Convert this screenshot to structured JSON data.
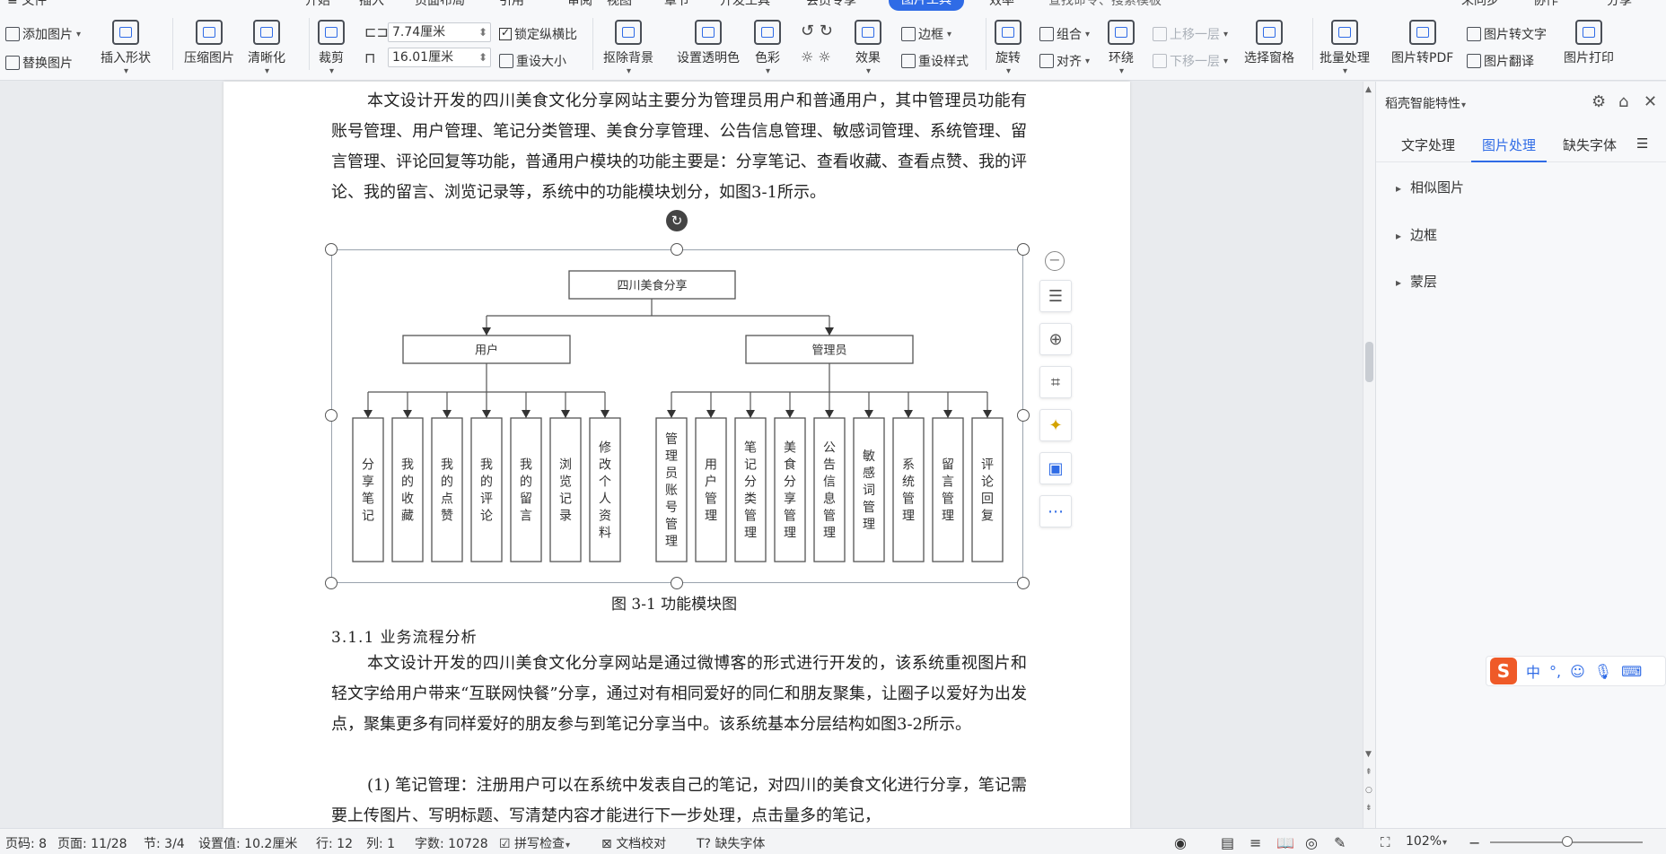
{
  "menu": {
    "items": [
      "文件",
      "开始",
      "插入",
      "页面布局",
      "引用",
      "审阅",
      "视图",
      "章节",
      "开发工具",
      "会员专享",
      "图片工具",
      "效率"
    ],
    "active": "图片工具",
    "right": [
      "未同步",
      "协作",
      "分享"
    ],
    "search_placeholder": "查找命令、搜索模板"
  },
  "ribbon": {
    "add_image": "添加图片",
    "replace_image": "替换图片",
    "insert_shape": "插入形状",
    "compress_image": "压缩图片",
    "sharpen": "清晰化",
    "crop": "裁剪",
    "height_value": "7.74厘米",
    "width_value": "16.01厘米",
    "lock_ratio": "锁定纵横比",
    "reset_size": "重设大小",
    "remove_bg": "抠除背景",
    "set_transparent": "设置透明色",
    "color": "色彩",
    "effects": "效果",
    "border": "边框",
    "reset_style": "重设样式",
    "rotate": "旋转",
    "group": "组合",
    "align": "对齐",
    "wrap": "环绕",
    "bring_forward": "上移一层",
    "send_backward": "下移一层",
    "selection_pane": "选择窗格",
    "batch_process": "批量处理",
    "to_pdf": "图片转PDF",
    "to_text": "图片转文字",
    "translate": "图片翻译",
    "print": "图片打印"
  },
  "document": {
    "para1": "本文设计开发的四川美食文化分享网站主要分为管理员用户和普通用户，其中管理员功能有账号管理、用户管理、笔记分类管理、美食分享管理、公告信息管理、敏感词管理、系统管理、留言管理、评论回复等功能，普通用户模块的功能主要是：分享笔记、查看收藏、查看点赞、我的评论、我的留言、浏览记录等，系统中的功能模块划分，如图3-1所示。",
    "caption": "图 3-1  功能模块图",
    "heading": "3.1.1 业务流程分析",
    "para2": "本文设计开发的四川美食文化分享网站是通过微博客的形式进行开发的，该系统重视图片和轻文字给用户带来“互联网快餐”分享，通过对有相同爱好的同仁和朋友聚集，让圈子以爱好为出发点，聚集更多有同样爱好的朋友参与到笔记分享当中。该系统基本分层结构如图3-2所示。",
    "para3": "(1) 笔记管理：注册用户可以在系统中发表自己的笔记，对四川的美食文化进行分享，笔记需要上传图片、写明标题、写清楚内容才能进行下一步处理，点击量多的笔记，"
  },
  "diagram": {
    "root": "四川美食分享",
    "user": "用户",
    "admin": "管理员",
    "user_children": [
      "分享笔记",
      "我的收藏",
      "我的点赞",
      "我的评论",
      "我的留言",
      "浏览记录",
      "修改个人资料"
    ],
    "admin_children": [
      "管理员账号管理",
      "用户管理",
      "笔记分类管理",
      "美食分享管理",
      "公告信息管理",
      "敏感词管理",
      "系统管理",
      "留言管理",
      "评论回复"
    ]
  },
  "panel": {
    "title": "稻壳智能特性",
    "tabs": [
      "文字处理",
      "图片处理",
      "缺失字体"
    ],
    "active_tab": "图片处理",
    "sections": [
      "相似图片",
      "边框",
      "蒙层"
    ]
  },
  "ime": {
    "mode": "中",
    "punct": "°,"
  },
  "status": {
    "page_code": "页码: 8",
    "page": "页面: 11/28",
    "section": "节: 3/4",
    "setting": "设置值: 10.2厘米",
    "row": "行: 12",
    "col": "列: 1",
    "word_count": "字数: 10728",
    "spell_check": "拼写检查",
    "doc_proof": "文档校对",
    "missing_font": "缺失字体",
    "zoom": "102%"
  }
}
